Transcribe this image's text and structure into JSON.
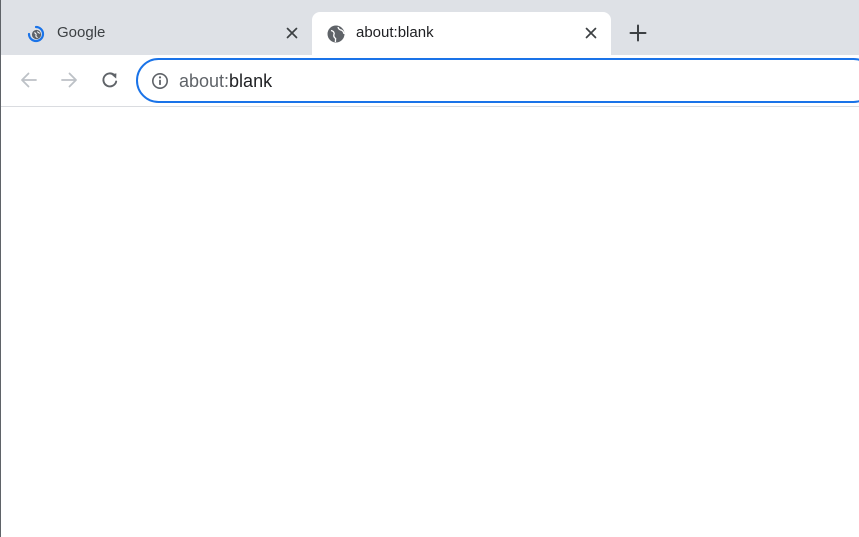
{
  "tabs": [
    {
      "title": "Google",
      "favicon": "google-loading-icon",
      "active": false
    },
    {
      "title": "about:blank",
      "favicon": "globe-icon",
      "active": true
    }
  ],
  "toolbar": {
    "back_icon": "arrow-left-icon",
    "forward_icon": "arrow-right-icon",
    "reload_icon": "reload-icon"
  },
  "omnibox": {
    "scheme": "about:",
    "path": "blank",
    "security_icon": "info-icon",
    "focus_color": "#1a73e8"
  },
  "colors": {
    "tabstrip_bg": "#dee1e6",
    "active_tab_bg": "#ffffff",
    "text": "#202124"
  }
}
